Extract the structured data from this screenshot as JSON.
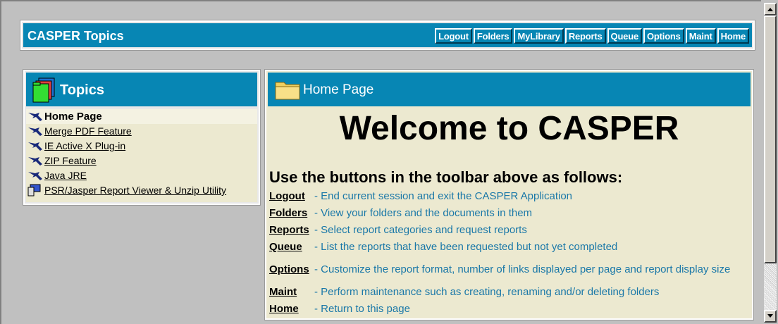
{
  "header": {
    "title": "CASPER Topics",
    "toolbar": [
      "Logout",
      "Folders",
      "MyLibrary",
      "Reports",
      "Queue",
      "Options",
      "Maint",
      "Home"
    ]
  },
  "topics": {
    "title": "Topics",
    "items": [
      {
        "label": "Home Page",
        "active": true
      },
      {
        "label": "Merge PDF Feature"
      },
      {
        "label": "IE Active X Plug-in"
      },
      {
        "label": "ZIP Feature"
      },
      {
        "label": "Java JRE"
      },
      {
        "label": "PSR/Jasper Report Viewer & Unzip Utility"
      }
    ]
  },
  "main": {
    "title": "Home Page",
    "welcome": "Welcome to CASPER",
    "instructions": "Use the buttons in the toolbar above as follows:",
    "rows": [
      {
        "key": "Logout",
        "desc": "- End current session and exit the CASPER Application"
      },
      {
        "key": "Folders",
        "desc": "- View your folders and the documents in them"
      },
      {
        "key": "Reports",
        "desc": "- Select report categories and request reports"
      },
      {
        "key": "Queue",
        "desc": "- List the reports that have been requested but not yet completed"
      },
      {
        "key": "Options",
        "desc": "- Customize the report format, number of links displayed per page and report display size"
      },
      {
        "key": "Maint",
        "desc": "- Perform maintenance such as creating, renaming and/or deleting folders"
      },
      {
        "key": "Home",
        "desc": "- Return to this page"
      }
    ]
  },
  "colors": {
    "accent": "#0786b4",
    "panel": "#ece9d0",
    "desc_text": "#1a78a8"
  }
}
